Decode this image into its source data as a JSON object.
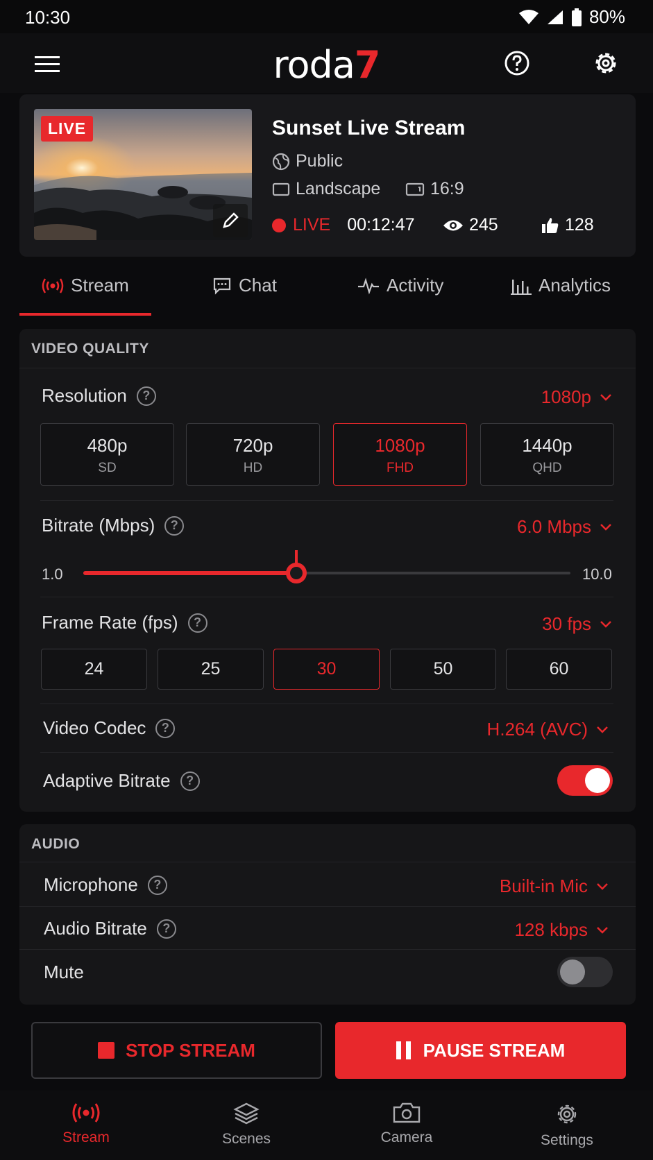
{
  "status_bar": {
    "time": "10:30",
    "battery": "80%"
  },
  "app_bar": {
    "logo_text": "roda",
    "logo_number": "7"
  },
  "stream": {
    "live_badge": "LIVE",
    "title": "Sunset Live Stream",
    "privacy": "Public",
    "orientation": "Landscape",
    "aspect_ratio": "16:9",
    "live_label": "LIVE",
    "duration": "00:12:47",
    "viewers": "245",
    "likes": "128"
  },
  "tabs": [
    {
      "label": "Stream",
      "active": true
    },
    {
      "label": "Chat",
      "active": false
    },
    {
      "label": "Activity",
      "active": false
    },
    {
      "label": "Analytics",
      "active": false
    }
  ],
  "video_quality": {
    "heading": "VIDEO QUALITY",
    "resolution": {
      "label": "Resolution",
      "value": "1080p",
      "options": [
        {
          "main": "480p",
          "sub": "SD"
        },
        {
          "main": "720p",
          "sub": "HD"
        },
        {
          "main": "1080p",
          "sub": "FHD"
        },
        {
          "main": "1440p",
          "sub": "QHD"
        }
      ],
      "selected_index": 2
    },
    "bitrate": {
      "label": "Bitrate (Mbps)",
      "value": "6.0 Mbps",
      "min_label": "1.0",
      "max_label": "10.0",
      "min": 1.0,
      "max": 10.0,
      "current": 6.0
    },
    "frame_rate": {
      "label": "Frame Rate (fps)",
      "value": "30 fps",
      "options": [
        "24",
        "25",
        "30",
        "50",
        "60"
      ],
      "selected_index": 2
    },
    "codec": {
      "label": "Video Codec",
      "value": "H.264 (AVC)"
    },
    "adaptive_bitrate": {
      "label": "Adaptive Bitrate",
      "enabled": true
    }
  },
  "audio": {
    "heading": "AUDIO",
    "microphone": {
      "label": "Microphone",
      "value": "Built-in Mic"
    },
    "audio_bitrate": {
      "label": "Audio Bitrate",
      "value": "128 kbps"
    },
    "mute": {
      "label": "Mute",
      "enabled": false
    }
  },
  "actions": {
    "stop_label": "STOP STREAM",
    "pause_label": "PAUSE STREAM"
  },
  "bottom_nav": [
    {
      "label": "Stream",
      "icon": "broadcast-icon",
      "active": true
    },
    {
      "label": "Scenes",
      "icon": "layers-icon",
      "active": false
    },
    {
      "label": "Camera",
      "icon": "camera-icon",
      "active": false
    },
    {
      "label": "Settings",
      "icon": "gear-icon",
      "active": false
    }
  ],
  "colors": {
    "accent": "#e8282c",
    "background": "#0b0b0d",
    "card": "#161618"
  }
}
